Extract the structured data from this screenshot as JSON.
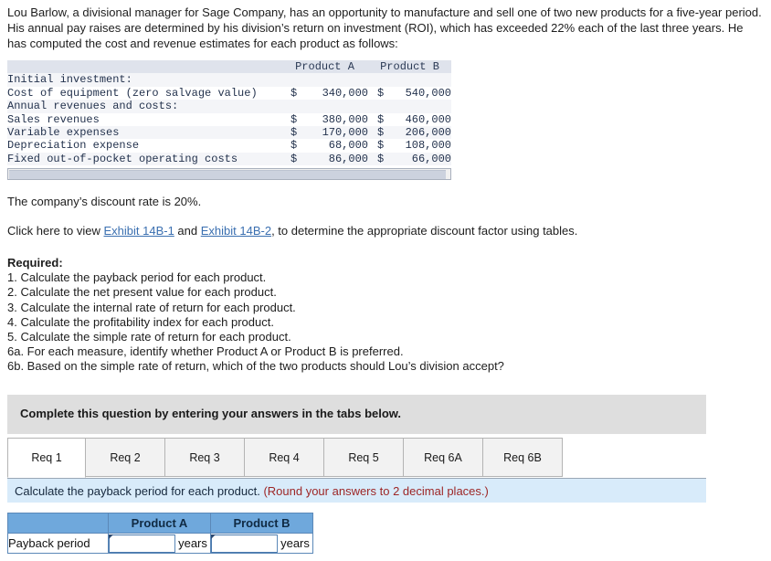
{
  "intro": "Lou Barlow, a divisional manager for Sage Company, has an opportunity to manufacture and sell one of two new products for a five-year period. His annual pay raises are determined by his division’s return on investment (ROI), which has exceeded 22% each of the last three years. He has computed the cost and revenue estimates for each product as follows:",
  "data_table": {
    "columns": [
      "",
      "Product A",
      "Product B"
    ],
    "rows": [
      {
        "label": "Initial investment:",
        "a": "",
        "b": "",
        "currency": false,
        "section": true
      },
      {
        "label": "Cost of equipment (zero salvage value)",
        "a": "340,000",
        "b": "540,000",
        "currency": true,
        "section": false
      },
      {
        "label": "Annual revenues and costs:",
        "a": "",
        "b": "",
        "currency": false,
        "section": true
      },
      {
        "label": "Sales revenues",
        "a": "380,000",
        "b": "460,000",
        "currency": true,
        "section": false
      },
      {
        "label": "Variable expenses",
        "a": "170,000",
        "b": "206,000",
        "currency": true,
        "section": false
      },
      {
        "label": "Depreciation expense",
        "a": "68,000",
        "b": "108,000",
        "currency": true,
        "section": false
      },
      {
        "label": "Fixed out-of-pocket operating costs",
        "a": "86,000",
        "b": "66,000",
        "currency": true,
        "section": false
      }
    ],
    "currency_symbol": "$"
  },
  "discount_text": "The company’s discount rate is 20%.",
  "click_here": {
    "lead": "Click here to view ",
    "link1": "Exhibit 14B-1",
    "mid": " and ",
    "link2": "Exhibit 14B-2",
    "tail": ", to determine the appropriate discount factor using tables."
  },
  "required": {
    "heading": "Required:",
    "items": [
      "1. Calculate the payback period for each product.",
      "2. Calculate the net present value for each product.",
      "3. Calculate the internal rate of return for each product.",
      "4. Calculate the profitability index for each product.",
      "5. Calculate the simple rate of return for each product.",
      "6a. For each measure, identify whether Product A or Product B is preferred.",
      "6b. Based on the simple rate of return, which of the two products should Lou’s division accept?"
    ]
  },
  "banner_text": "Complete this question by entering your answers in the tabs below.",
  "tabs": [
    {
      "label": "Req 1",
      "active": true
    },
    {
      "label": "Req 2",
      "active": false
    },
    {
      "label": "Req 3",
      "active": false
    },
    {
      "label": "Req 4",
      "active": false
    },
    {
      "label": "Req 5",
      "active": false
    },
    {
      "label": "Req 6A",
      "active": false
    },
    {
      "label": "Req 6B",
      "active": false
    }
  ],
  "instruction": {
    "main": "Calculate the payback period for each product. ",
    "round": "(Round your answers to 2 decimal places.)"
  },
  "answer_table": {
    "corner": "",
    "col_a": "Product A",
    "col_b": "Product B",
    "row_label": "Payback period",
    "unit": "years",
    "value_a": "",
    "value_b": "",
    "placeholder": ""
  },
  "colors": {
    "header_blue": "#6fa8dc",
    "instruction_blue": "#d8ebfa",
    "banner_gray": "#dedede",
    "link_blue": "#3a6fb0",
    "round_red": "#9d2626"
  }
}
